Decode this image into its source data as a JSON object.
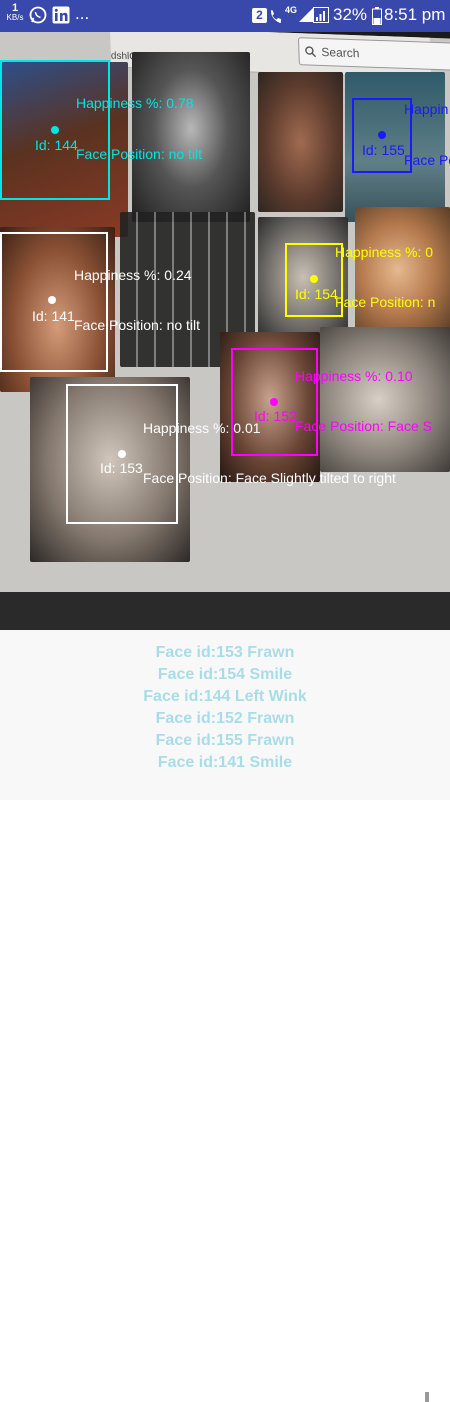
{
  "status_bar": {
    "net_speed_value": "1",
    "net_speed_unit": "KB/s",
    "ellipsis": "...",
    "sim_badge": "2",
    "network_type": "4G",
    "battery_percent": "32%",
    "time": "8:51 pm"
  },
  "camera": {
    "browser_search_placeholder": "Search",
    "browser_tab_fragment": "dshlOu-BNadr",
    "faces": [
      {
        "id_label": "Id: 144",
        "happiness": "Happiness %: 0.78",
        "position": "Face Position: no tilt",
        "color": "#00e5e5"
      },
      {
        "id_label": "Id: 155",
        "happiness": "Happin",
        "position": "Face Po",
        "color": "#1a1aff"
      },
      {
        "id_label": "Id: 141",
        "happiness": "Happiness %: 0.24",
        "position": "Face Position: no tilt",
        "color": "#ffffff"
      },
      {
        "id_label": "Id: 154",
        "happiness": "Happiness %: 0",
        "position": "Face Position: n",
        "color": "#ffff00"
      },
      {
        "id_label": "Id: 152",
        "happiness": "Happiness %: 0.10",
        "position": "Face Position: Face S",
        "color": "#ff00ff"
      },
      {
        "id_label": "Id: 153",
        "happiness": "Happiness %: 0.01",
        "position": "Face Position: Face Slightly tilted to right",
        "color": "#ffffff"
      }
    ]
  },
  "results": [
    "Face id:153 Frawn",
    "Face id:154 Smile",
    "Face id:144 Left Wink",
    "Face id:152 Frawn",
    "Face id:155 Frawn",
    "Face id:141 Smile"
  ]
}
